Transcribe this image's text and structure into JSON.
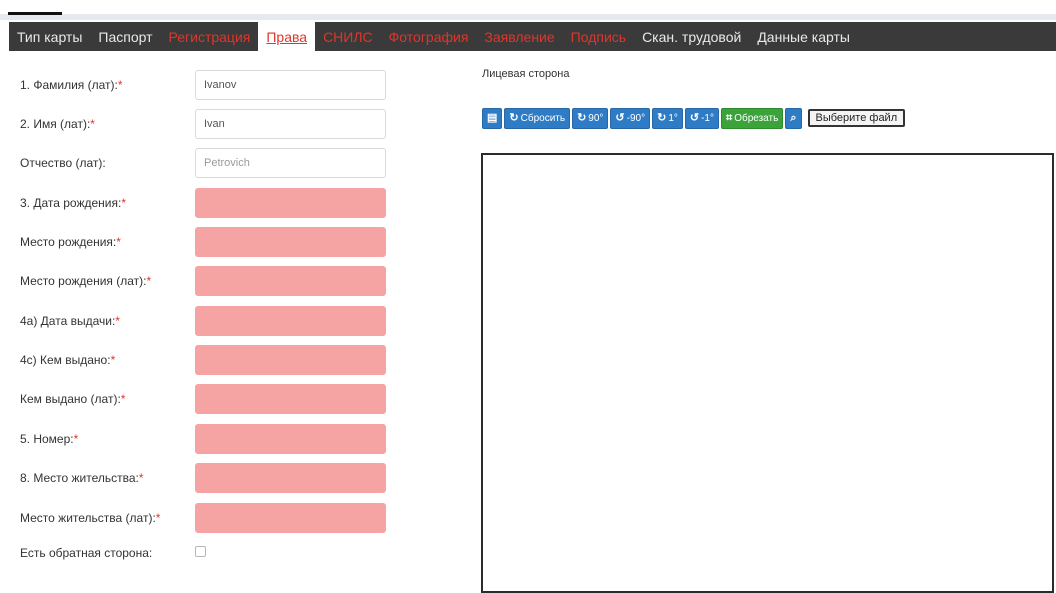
{
  "tabs": [
    {
      "label": "Тип карты"
    },
    {
      "label": "Паспорт"
    },
    {
      "label": "Регистрация"
    },
    {
      "label": "Права"
    },
    {
      "label": "СНИЛС"
    },
    {
      "label": "Фотография"
    },
    {
      "label": "Заявление"
    },
    {
      "label": "Подпись"
    },
    {
      "label": "Скан. трудовой"
    },
    {
      "label": "Данные карты"
    }
  ],
  "form": {
    "fields": [
      {
        "label": "1. Фамилия (лат):",
        "required": true,
        "value": "Ivanov"
      },
      {
        "label": "2. Имя (лат):",
        "required": true,
        "value": "Ivan"
      },
      {
        "label": "Отчество (лат):",
        "required": false,
        "placeholder": "Petrovich"
      },
      {
        "label": "3. Дата рождения:",
        "required": true,
        "value": ""
      },
      {
        "label": "Место рождения:",
        "required": true,
        "value": ""
      },
      {
        "label": "Место рождения (лат):",
        "required": true,
        "value": ""
      },
      {
        "label": "4a) Дата выдачи:",
        "required": true,
        "value": ""
      },
      {
        "label": "4c) Кем выдано:",
        "required": true,
        "value": ""
      },
      {
        "label": "Кем выдано (лат):",
        "required": true,
        "value": ""
      },
      {
        "label": "5. Номер:",
        "required": true,
        "value": ""
      },
      {
        "label": "8. Место жительства:",
        "required": true,
        "value": ""
      },
      {
        "label": "Место жительства (лат):",
        "required": true,
        "value": ""
      }
    ],
    "backside_label": "Есть обратная сторона:",
    "required_mark": "*"
  },
  "image_panel": {
    "title": "Лицевая сторона",
    "buttons": {
      "reset": "Сбросить",
      "rot_plus_90": "90°",
      "rot_minus_90": "-90°",
      "rot_plus_1": "1°",
      "rot_minus_1": "-1°",
      "crop": "Обрезать"
    },
    "file_button": "Выберите файл"
  },
  "colors": {
    "tab_bar": "#3a3a3a",
    "tab_error": "#e0352b",
    "field_error": "#f5a3a3",
    "toolbar_blue": "#2f7cc6",
    "toolbar_green": "#3aa33a"
  },
  "icons": [
    "file-icon",
    "refresh-icon",
    "rotate-cw-icon",
    "rotate-ccw-icon",
    "crop-icon",
    "search-icon"
  ]
}
